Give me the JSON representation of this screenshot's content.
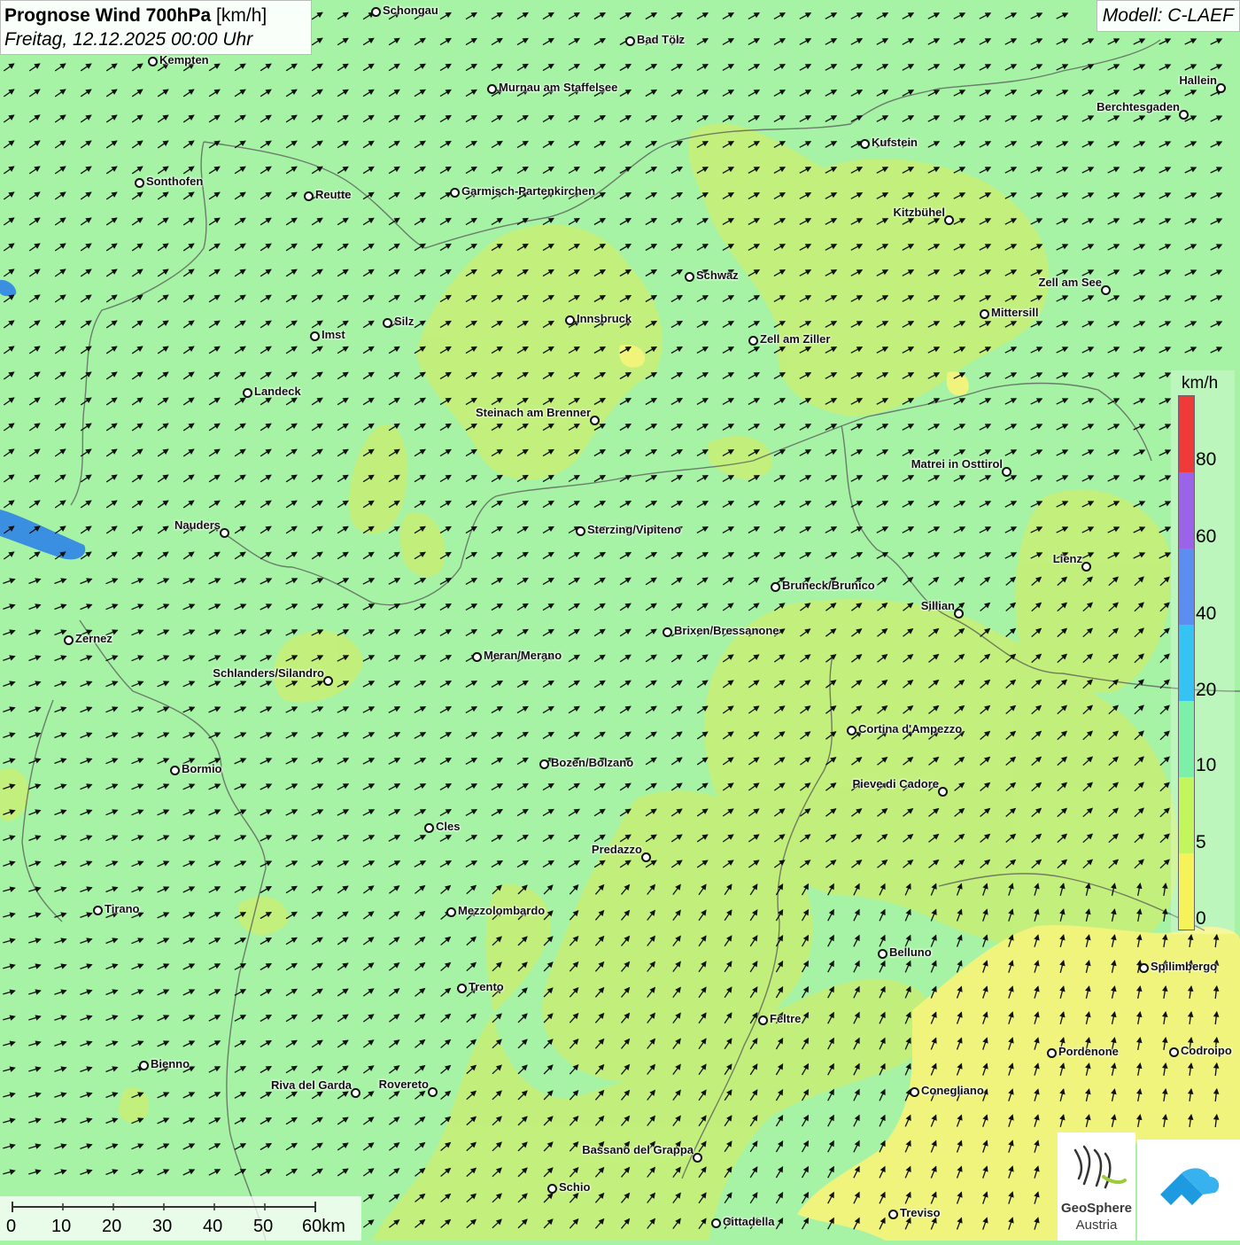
{
  "header": {
    "title": "Prognose Wind 700hPa",
    "unit": "[km/h]",
    "date": "Freitag, 12.12.2025 00:00 Uhr"
  },
  "model": "Modell: C-LAEF",
  "legend": {
    "unit": "km/h",
    "labels": [
      "80",
      "60",
      "40",
      "20",
      "10",
      "5",
      "0"
    ],
    "colors": [
      "#f03a3a",
      "#9a63e8",
      "#5b8ef0",
      "#35c3f3",
      "#7cefa8",
      "#c3f55c",
      "#f6f35a"
    ]
  },
  "scale": {
    "labels": [
      "0",
      "10",
      "20",
      "30",
      "40",
      "50",
      "60km"
    ]
  },
  "logo": {
    "name1": "GeoSphere",
    "name2": "Austria"
  },
  "map_colors": {
    "background": "#a6f3a6",
    "light_wind": "#c8ef74",
    "calm": "#f3f37a",
    "water": "#3a8fe0",
    "border": "#555555"
  },
  "cities": [
    {
      "name": "Schongau"
    },
    {
      "name": "Bad Tölz"
    },
    {
      "name": "Kempten"
    },
    {
      "name": "Murnau am Staffelsee"
    },
    {
      "name": "Hallein"
    },
    {
      "name": "Berchtesgaden"
    },
    {
      "name": "Kufstein"
    },
    {
      "name": "Sonthofen"
    },
    {
      "name": "Reutte"
    },
    {
      "name": "Garmisch-Partenkirchen"
    },
    {
      "name": "Kitzbühel"
    },
    {
      "name": "Schwaz"
    },
    {
      "name": "Zell am See"
    },
    {
      "name": "Innsbruck"
    },
    {
      "name": "Silz"
    },
    {
      "name": "Mittersill"
    },
    {
      "name": "Imst"
    },
    {
      "name": "Zell am Ziller"
    },
    {
      "name": "Landeck"
    },
    {
      "name": "Steinach am Brenner"
    },
    {
      "name": "Matrei in Osttirol"
    },
    {
      "name": "Nauders"
    },
    {
      "name": "Sterzing/Vipiteno"
    },
    {
      "name": "Lienz"
    },
    {
      "name": "Bruneck/Brunico"
    },
    {
      "name": "Sillian"
    },
    {
      "name": "Zernez"
    },
    {
      "name": "Brixen/Bressanone"
    },
    {
      "name": "Meran/Merano"
    },
    {
      "name": "Schlanders/Silandro"
    },
    {
      "name": "Cortina d'Ampezzo"
    },
    {
      "name": "Bozen/Bolzano"
    },
    {
      "name": "Bormio"
    },
    {
      "name": "Pieve di Cadore"
    },
    {
      "name": "Cles"
    },
    {
      "name": "Predazzo"
    },
    {
      "name": "Tirano"
    },
    {
      "name": "Mezzolombardo"
    },
    {
      "name": "Belluno"
    },
    {
      "name": "Spilimbergo"
    },
    {
      "name": "Trento"
    },
    {
      "name": "Feltre"
    },
    {
      "name": "Pordenone"
    },
    {
      "name": "Codroipo"
    },
    {
      "name": "Bienno"
    },
    {
      "name": "Riva del Garda"
    },
    {
      "name": "Rovereto"
    },
    {
      "name": "Conegliano"
    },
    {
      "name": "Bassano del Grappa"
    },
    {
      "name": "Schio"
    },
    {
      "name": "Treviso"
    },
    {
      "name": "Cittadella"
    }
  ]
}
